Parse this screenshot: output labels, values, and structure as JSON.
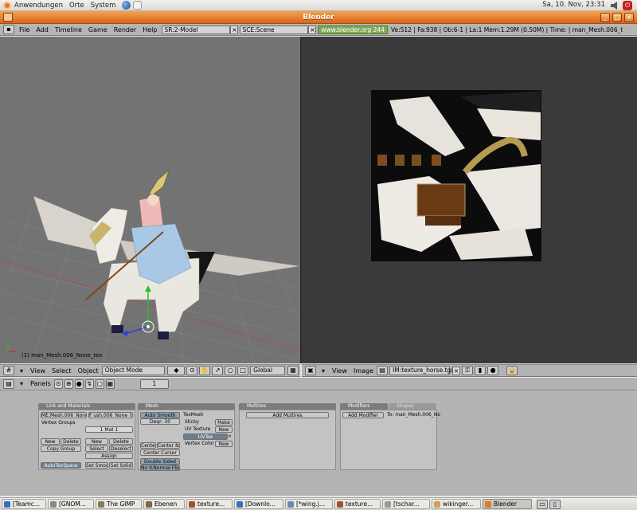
{
  "gnome_panel": {
    "menus": [
      "Anwendungen",
      "Orte",
      "System"
    ],
    "clock": "Sa, 10. Nov, 23:31"
  },
  "window": {
    "title": "Blender"
  },
  "blender_header": {
    "menus": [
      "File",
      "Add",
      "Timeline",
      "Game",
      "Render",
      "Help"
    ],
    "screen": "SR:2-Model",
    "scene": "SCE:Scene",
    "url": "www.blender.org 244",
    "stats": "Ve:512 | Fa:938 | Ob:6-1 | La:1  Mem:1.29M (0.50M) | Time: | man_Mesh.006_t"
  },
  "view3d": {
    "object_label": "(1) man_Mesh.006_None_tex"
  },
  "view3d_header": {
    "menus": [
      "View",
      "Select",
      "Object"
    ],
    "mode": "Object Mode",
    "orientation": "Global"
  },
  "image_header": {
    "menus": [
      "View",
      "Image"
    ],
    "image_name": "IM:texture_horse.tga"
  },
  "buttons_header": {
    "panels_label": "Panels",
    "frame": "1"
  },
  "panels": {
    "link_materials": {
      "tab": "Link and Materials",
      "mesh_field": "ME:Mesh.006_None_tex",
      "obj_field": "F ush.006_None_tex",
      "vertex_groups": "Vertex Groups",
      "mat_field": "1 Mat 1",
      "new": "New",
      "delete": "Delete",
      "copy_group": "Copy Group",
      "new2": "New",
      "delete2": "Delete",
      "select": "Select",
      "deselect": "Deselect",
      "assign": "Assign",
      "autotexspace": "AutoTexSpace",
      "set_smooth": "Set Smooth",
      "set_solid": "Set Solid"
    },
    "mesh": {
      "tab": "Mesh",
      "auto_smooth": "Auto Smooth",
      "degr": "Degr: 30",
      "texmesh": "TexMesh",
      "sticky": "Sticky",
      "make": "Make",
      "uv_texture": "UV Texture",
      "new": "New",
      "uvtex": "UVTex",
      "vertex_color": "Vertex Color",
      "new2": "New",
      "center": "Center",
      "center_new": "Center New",
      "center_cursor": "Center Cursor",
      "double_sided": "Double Sided",
      "no_vnormal_flip": "No V.Normal Flip"
    },
    "multires": {
      "tab": "Multires",
      "add": "Add Multires"
    },
    "modifiers": {
      "tab": "Modifiers",
      "tab2": "Shapes",
      "add": "Add Modifier",
      "target": "To: man_Mesh.006_No"
    }
  },
  "taskbar": {
    "tasks": [
      "[Teamc...",
      "[GNOM...",
      "The GIMP",
      "Ebenen",
      "texture...",
      "[Downlo...",
      "[*wing.j...",
      "texture...",
      "[tschar...",
      "wikinger...",
      "Blender"
    ]
  },
  "colors": {
    "title_orange": "#e07a2a",
    "viewport_gray": "#737373",
    "image_bg": "#3a3a3a",
    "url_green": "#7dab5a"
  }
}
